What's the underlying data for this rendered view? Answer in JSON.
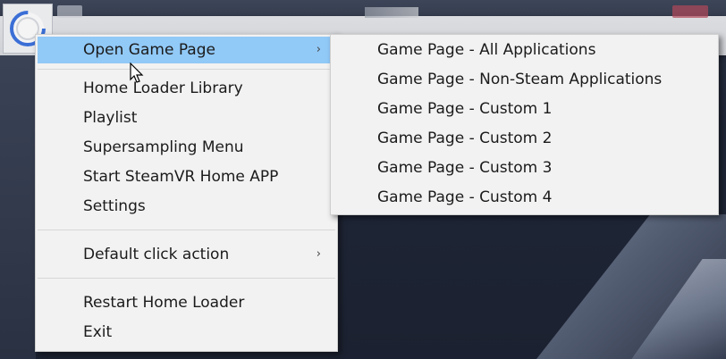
{
  "context_menu": {
    "items": [
      {
        "label": "Open Game Page",
        "has_submenu": true,
        "highlighted": true
      },
      {
        "label": "Home Loader Library"
      },
      {
        "label": "Playlist"
      },
      {
        "label": "Supersampling Menu"
      },
      {
        "label": "Start SteamVR Home APP"
      },
      {
        "label": "Settings"
      },
      {
        "label": "Default click action",
        "has_submenu": true
      },
      {
        "label": "Restart Home Loader"
      },
      {
        "label": "Exit"
      }
    ],
    "submenu_arrow": "›"
  },
  "submenu": {
    "items": [
      {
        "label": "Game Page - All Applications"
      },
      {
        "label": "Game Page - Non-Steam Applications"
      },
      {
        "label": "Game Page - Custom 1"
      },
      {
        "label": "Game Page - Custom 2"
      },
      {
        "label": "Game Page - Custom 3"
      },
      {
        "label": "Game Page - Custom 4"
      }
    ]
  },
  "icons": {
    "tray": "home-loader-tray-icon",
    "cursor": "mouse-pointer-icon"
  },
  "colors": {
    "highlight": "#91c9f7",
    "menu_bg": "#f2f2f2",
    "text": "#1b1b1b"
  }
}
